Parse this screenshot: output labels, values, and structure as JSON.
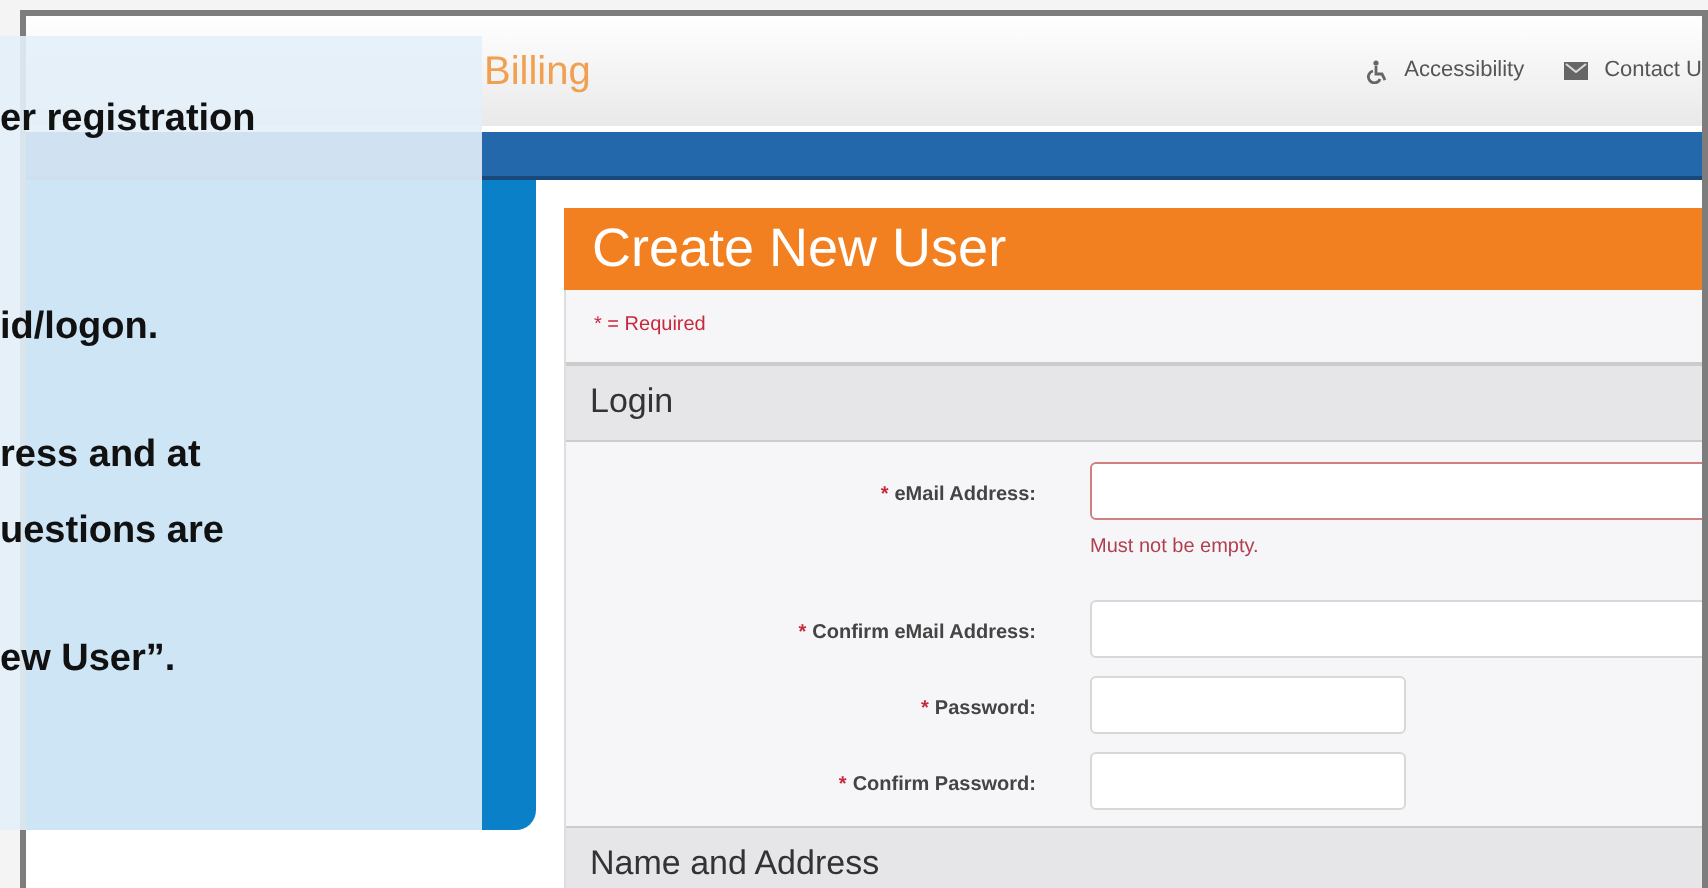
{
  "header": {
    "logo_text": "Billing",
    "links": [
      {
        "kind": "accessibility",
        "label": "Accessibility"
      },
      {
        "kind": "mail",
        "label": "Contact U"
      }
    ]
  },
  "callout": {
    "paragraphs": [
      [
        "er registration"
      ],
      [
        "id/logon."
      ],
      [
        "ress and at",
        "uestions are"
      ],
      [
        "ew User”."
      ]
    ]
  },
  "form": {
    "title": "Create New User",
    "required_note": "* = Required",
    "sections": [
      {
        "title": "Login",
        "fields": [
          {
            "mark": "*",
            "label": "eMail Address:",
            "kind": "wide",
            "invalid": true,
            "error": "Must not be empty."
          },
          {
            "mark": "*",
            "label": "Confirm eMail Address:",
            "kind": "wide",
            "invalid": false
          },
          {
            "mark": "*",
            "label": "Password:",
            "kind": "short",
            "invalid": false
          },
          {
            "mark": "*",
            "label": "Confirm Password:",
            "kind": "short",
            "invalid": false
          }
        ]
      },
      {
        "title": "Name and Address"
      }
    ]
  }
}
